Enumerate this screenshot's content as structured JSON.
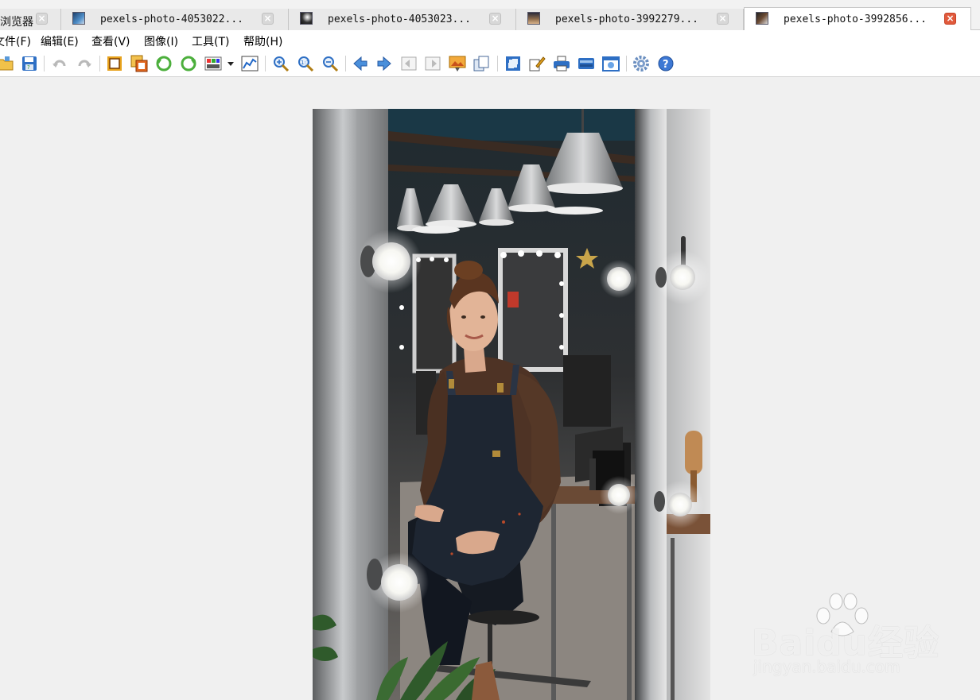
{
  "tabs": [
    {
      "title": "浏览器",
      "active": false,
      "thumb": "app-thumb"
    },
    {
      "title": "pexels-photo-4053022...",
      "active": false,
      "thumb": "photo-thumb"
    },
    {
      "title": "pexels-photo-4053023...",
      "active": false,
      "thumb": "photo-thumb"
    },
    {
      "title": "pexels-photo-3992279...",
      "active": false,
      "thumb": "photo-thumb"
    },
    {
      "title": "pexels-photo-3992856...",
      "active": true,
      "thumb": "photo-thumb"
    }
  ],
  "tab_close_glyph": "×",
  "menu": [
    "文件(F)",
    "编辑(E)",
    "查看(V)",
    "图像(I)",
    "工具(T)",
    "帮助(H)"
  ],
  "toolbar": [
    "open-folder-icon",
    "save-icon",
    "undo-icon",
    "redo-icon",
    "crop-icon",
    "resize-icon",
    "rotate-left-icon",
    "rotate-right-icon",
    "color-adjust-icon",
    "dropdown-arrow-icon",
    "histogram-icon",
    "zoom-in-icon",
    "zoom-actual-icon",
    "zoom-out-icon",
    "previous-icon",
    "next-icon",
    "first-image-icon",
    "last-image-icon",
    "slideshow-icon",
    "copy-icon",
    "fit-window-icon",
    "batch-edit-icon",
    "print-icon",
    "scan-icon",
    "capture-icon",
    "settings-icon",
    "help-icon"
  ],
  "image": {
    "subject": "photo-woman-in-salon-mirror"
  },
  "watermark": {
    "main": "Baidu经验",
    "sub": "jingyan.baidu.com"
  },
  "colors": {
    "accent_close": "#e15a3c",
    "toolbar_blue": "#2e6fc4"
  }
}
